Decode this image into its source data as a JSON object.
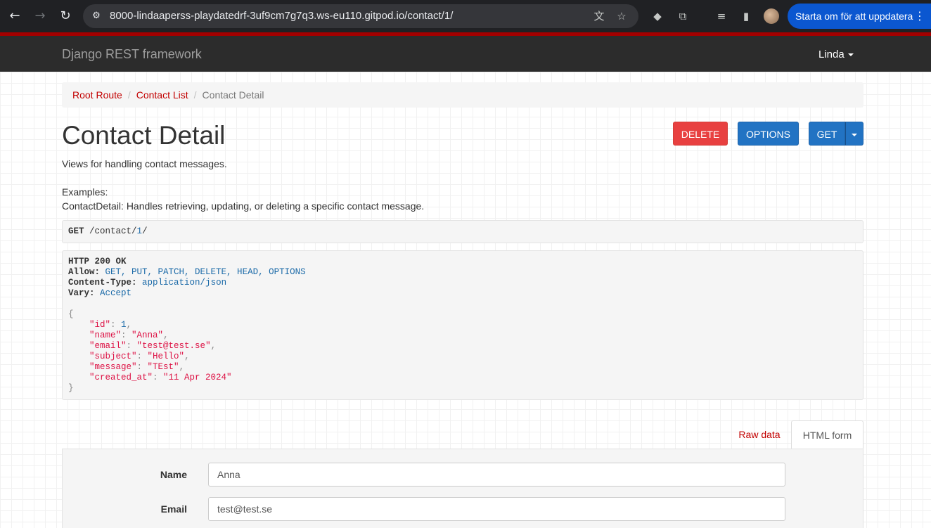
{
  "browser": {
    "url": "8000-lindaaperss-playdatedrf-3uf9cm7g7q3.ws-eu110.gitpod.io/contact/1/",
    "update_button_label": "Starta om för att uppdatera"
  },
  "navbar": {
    "brand": "Django REST framework",
    "user": "Linda"
  },
  "breadcrumb": {
    "items": [
      "Root Route",
      "Contact List"
    ],
    "active": "Contact Detail",
    "separator": "/"
  },
  "page": {
    "title": "Contact Detail",
    "description": "Views for handling contact messages.",
    "examples_label": "Examples:",
    "examples_text": "ContactDetail: Handles retrieving, updating, or deleting a specific contact message."
  },
  "actions": {
    "delete_label": "DELETE",
    "options_label": "OPTIONS",
    "get_label": "GET"
  },
  "request": {
    "method": "GET",
    "path_prefix": "/contact/",
    "path_id": "1",
    "path_suffix": "/"
  },
  "response": {
    "status": "HTTP 200 OK",
    "headers": [
      {
        "name": "Allow:",
        "value": "GET, PUT, PATCH, DELETE, HEAD, OPTIONS"
      },
      {
        "name": "Content-Type:",
        "value": "application/json"
      },
      {
        "name": "Vary:",
        "value": "Accept"
      }
    ],
    "open_brace": "{",
    "close_brace": "}",
    "body": [
      {
        "key": "\"id\"",
        "value": "1",
        "type": "number"
      },
      {
        "key": "\"name\"",
        "value": "\"Anna\"",
        "type": "string"
      },
      {
        "key": "\"email\"",
        "value": "\"test@test.se\"",
        "type": "string"
      },
      {
        "key": "\"subject\"",
        "value": "\"Hello\"",
        "type": "string"
      },
      {
        "key": "\"message\"",
        "value": "\"TEst\"",
        "type": "string"
      },
      {
        "key": "\"created_at\"",
        "value": "\"11 Apr 2024\"",
        "type": "string"
      }
    ]
  },
  "tabs": {
    "raw": "Raw data",
    "html": "HTML form"
  },
  "form": {
    "name_label": "Name",
    "name_value": "Anna",
    "email_label": "Email",
    "email_value": "test@test.se"
  }
}
